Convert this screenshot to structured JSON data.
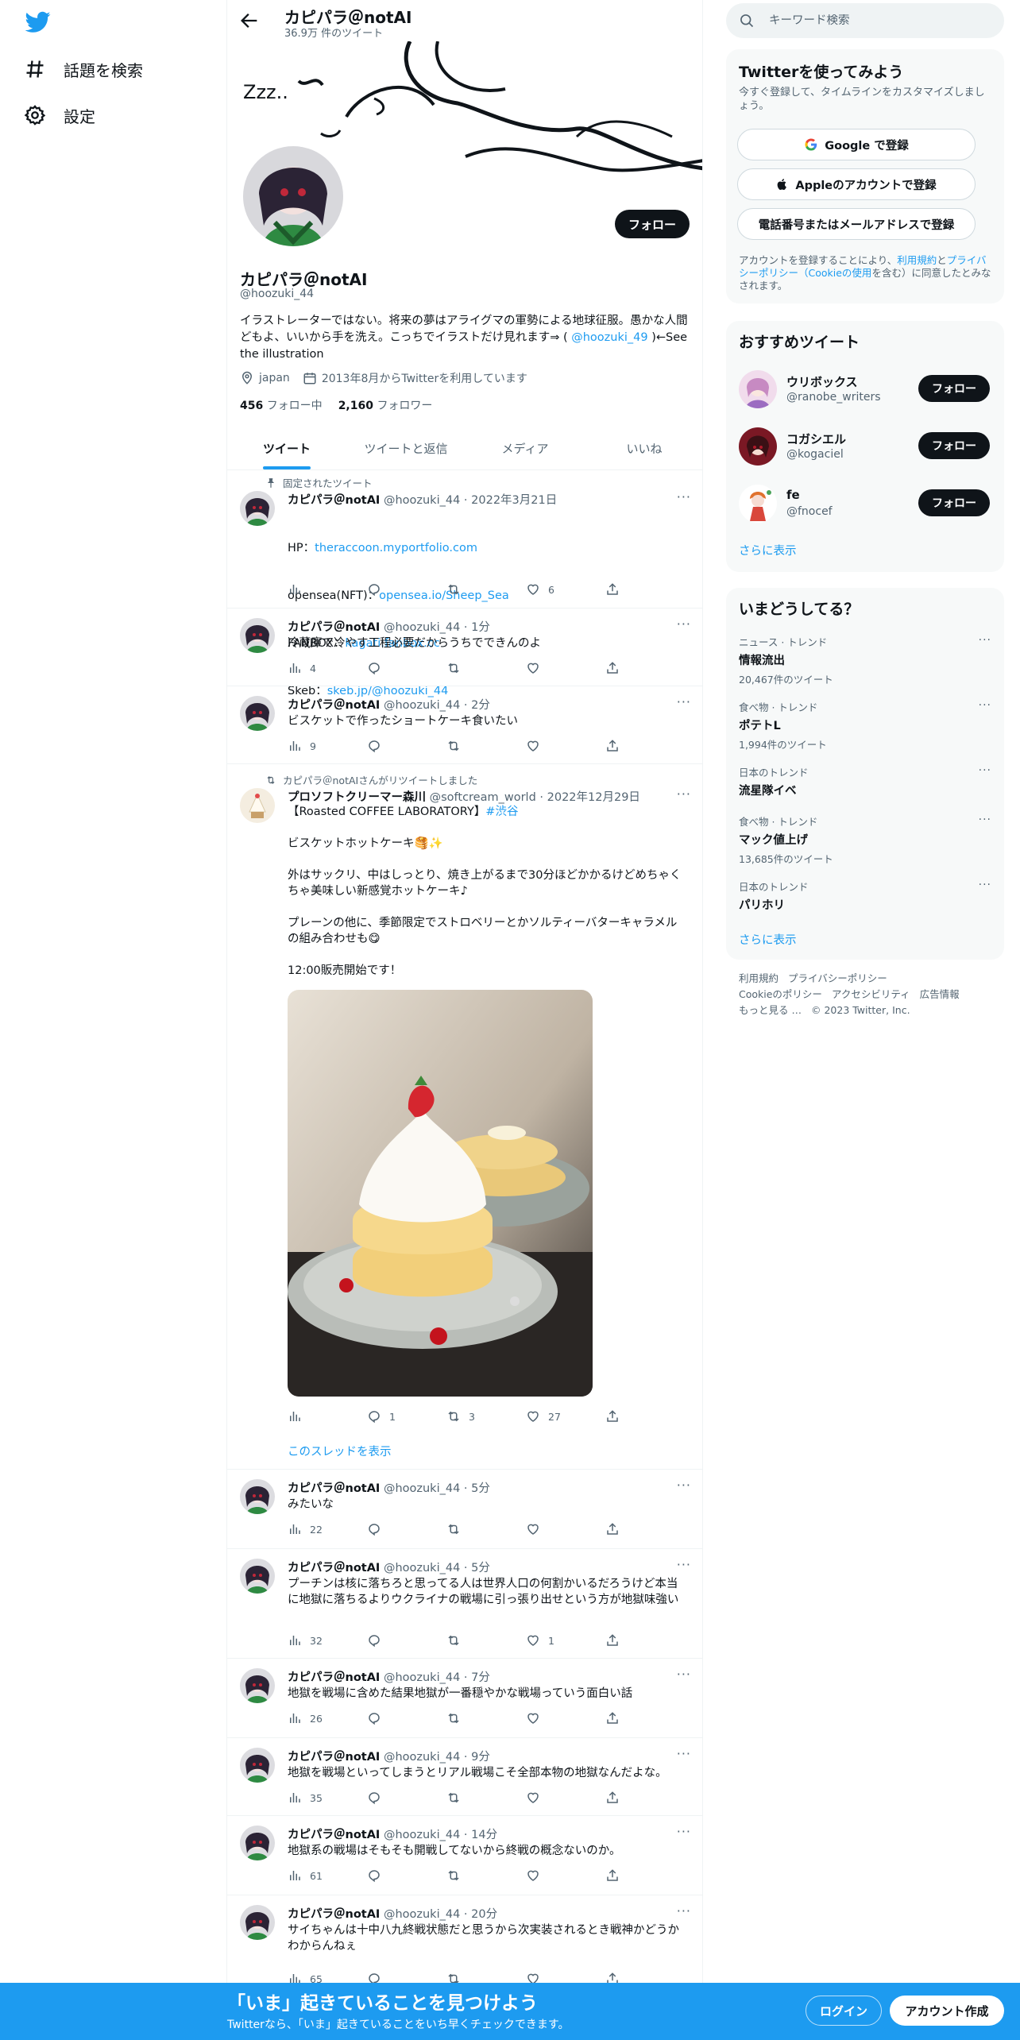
{
  "nav": {
    "explore_label": "話題を検索",
    "settings_label": "設定"
  },
  "profile": {
    "header_title": "カピパラ＠notAI",
    "tweet_count": "36.9万 件のツイート",
    "name": "カピパラ＠notAI",
    "handle": "@hoozuki_44",
    "bio_text": "イラストレーターではない。将来の夢はアライグマの軍勢による地球征服。愚かな人間どもよ、いいから手を洗え。こっちでイラストだけ見れます⇒ ( ",
    "bio_link": "@hoozuki_49",
    "bio_tail": " )←See the illustration",
    "location": "japan",
    "joined": "2013年8月からTwitterを利用しています",
    "following_count": "456",
    "following_label": "フォロー中",
    "followers_count": "2,160",
    "followers_label": "フォロワー",
    "follow_button": "フォロー"
  },
  "tabs": [
    {
      "label": "ツイート",
      "active": true
    },
    {
      "label": "ツイートと返信",
      "active": false
    },
    {
      "label": "メディア",
      "active": false
    },
    {
      "label": "いいね",
      "active": false
    }
  ],
  "pinned": {
    "context": "固定されたツイート",
    "name": "カピパラ＠notAI",
    "meta": "@hoozuki_44 · 2022年3月21日",
    "lines": [
      {
        "prefix": "HP：",
        "link": "theraccoon.myportfolio.com"
      },
      {
        "prefix": "opensea(NFT)：",
        "link": "opensea.io/Sheep_Sea"
      },
      {
        "prefix": "FANBOX：",
        "link": "kagati.fanbox.cc"
      },
      {
        "prefix": "Skeb：",
        "link": "skeb.jp/@hoozuki_44"
      }
    ],
    "stats": {
      "views": "",
      "replies": "",
      "retweets": "",
      "likes": "6"
    }
  },
  "tweets": [
    {
      "name": "カピパラ＠notAI",
      "meta": "@hoozuki_44 · 1分",
      "text": "冷蔵庫で冷やす工程必要だからうちでできんのよ",
      "views": "4",
      "replies": "",
      "retweets": "",
      "likes": ""
    },
    {
      "name": "カピパラ＠notAI",
      "meta": "@hoozuki_44 · 2分",
      "text": "ビスケットで作ったショートケーキ食いたい",
      "views": "9",
      "replies": "",
      "retweets": "",
      "likes": ""
    },
    {
      "name": "カピパラ＠notAI",
      "meta": "@hoozuki_44 · 5分",
      "text": "みたいな",
      "views": "22",
      "replies": "",
      "retweets": "",
      "likes": ""
    },
    {
      "name": "カピパラ＠notAI",
      "meta": "@hoozuki_44 · 5分",
      "text": "プーチンは核に落ちろと思ってる人は世界人口の何割かいるだろうけど本当に地獄に落ちるよりウクライナの戦場に引っ張り出せという方が地獄味強い",
      "views": "32",
      "replies": "",
      "retweets": "",
      "likes": "1"
    },
    {
      "name": "カピパラ＠notAI",
      "meta": "@hoozuki_44 · 7分",
      "text": "地獄を戦場に含めた結果地獄が一番穏やかな戦場っていう面白い話",
      "views": "26",
      "replies": "",
      "retweets": "",
      "likes": ""
    },
    {
      "name": "カピパラ＠notAI",
      "meta": "@hoozuki_44 · 9分",
      "text": "地獄を戦場といってしまうとリアル戦場こそ全部本物の地獄なんだよな。",
      "views": "35",
      "replies": "",
      "retweets": "",
      "likes": ""
    },
    {
      "name": "カピパラ＠notAI",
      "meta": "@hoozuki_44 · 14分",
      "text": "地獄系の戦場はそもそも開戦してないから終戦の概念ないのか。",
      "views": "61",
      "replies": "",
      "retweets": "",
      "likes": ""
    },
    {
      "name": "カピパラ＠notAI",
      "meta": "@hoozuki_44 · 20分",
      "text": "サイちゃんは十中八九終戦状態だと思うから次実装されるとき戦神かどうかわからんねぇ",
      "views": "65",
      "replies": "",
      "retweets": "",
      "likes": ""
    }
  ],
  "retweet": {
    "context": "カピパラ＠notAIさんがリツイートしました",
    "name": "プロソフトクリーマー森川",
    "meta": "@softcream_world · 2022年12月29日",
    "text_head": "【Roasted COFFEE LABORATORY】",
    "hashtag": "#渋谷",
    "text_body": "ビスケットホットケーキ🥞✨\n\n外はサックリ、中はしっとり、焼き上がるまで30分ほどかかるけどめちゃくちゃ美味しい新感覚ホットケーキ♪\n\nプレーンの他に、季節限定でストロベリーとかソルティーバターキャラメルの組み合わせも😋\n\n12:00販売開始です！",
    "views": "",
    "replies": "1",
    "retweets": "3",
    "likes": "27",
    "thread_link": "このスレッドを表示"
  },
  "right": {
    "search_placeholder": "キーワード検索",
    "signup": {
      "title": "Twitterを使ってみよう",
      "desc": "今すぐ登録して、タイムラインをカスタマイズしましょう。",
      "google": "Google で登録",
      "apple": "Appleのアカウントで登録",
      "phone": "電話番号またはメールアドレスで登録",
      "legal_pre": "アカウントを登録することにより、",
      "legal_terms": "利用規約",
      "legal_mid": "と",
      "legal_privacy": "プライバシーポリシー（Cookieの使用",
      "legal_post": "を含む）に同意したとみなされます。"
    },
    "recommend": {
      "title": "おすすめツイート",
      "items": [
        {
          "name": "ウリボックス",
          "handle": "@ranobe_writers",
          "button": "フォロー"
        },
        {
          "name": "コガシエル",
          "handle": "@kogaciel",
          "button": "フォロー"
        },
        {
          "name": "fe",
          "handle": "@fnocef",
          "button": "フォロー"
        }
      ],
      "more": "さらに表示"
    },
    "trends": {
      "title": "いまどうしてる？",
      "items": [
        {
          "category": "ニュース · トレンド",
          "topic": "情報流出",
          "count": "20,467件のツイート"
        },
        {
          "category": "食べ物 · トレンド",
          "topic": "ポテトL",
          "count": "1,994件のツイート"
        },
        {
          "category": "日本のトレンド",
          "topic": "流星隊イベ",
          "count": ""
        },
        {
          "category": "食べ物 · トレンド",
          "topic": "マック値上げ",
          "count": "13,685件のツイート"
        },
        {
          "category": "日本のトレンド",
          "topic": "パリホリ",
          "count": ""
        }
      ],
      "more": "さらに表示"
    },
    "footer": [
      "利用規約",
      "プライバシーポリシー",
      "Cookieのポリシー",
      "アクセシビリティ",
      "広告情報",
      "もっと見る …",
      "© 2023 Twitter, Inc."
    ]
  },
  "bottom": {
    "title": "「いま」起きていることを見つけよう",
    "subtitle": "Twitterなら、「いま」起きていることをいち早くチェックできます。",
    "login": "ログイン",
    "signup": "アカウント作成"
  }
}
